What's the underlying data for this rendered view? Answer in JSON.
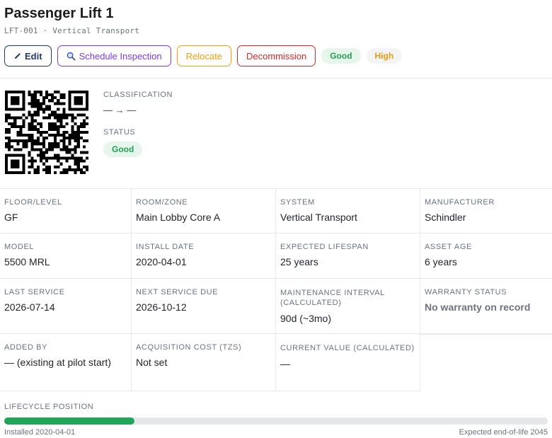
{
  "asset": {
    "title": "Passenger Lift 1",
    "subtitle": "LFT-001 · Vertical Transport"
  },
  "actions": {
    "edit": "Edit",
    "schedule_inspection": "Schedule Inspection",
    "relocate": "Relocate",
    "decommission": "Decommission"
  },
  "badges": {
    "condition": "Good",
    "criticality": "High"
  },
  "icons": {
    "edit": "pencil-icon",
    "schedule_inspection": "magnifier-icon"
  },
  "classification": {
    "label": "CLASSIFICATION",
    "value": "— → —"
  },
  "status": {
    "label": "STATUS",
    "value": "Good"
  },
  "details": [
    [
      {
        "label": "FLOOR/LEVEL",
        "value": "GF"
      },
      {
        "label": "ROOM/ZONE",
        "value": "Main Lobby Core A"
      },
      {
        "label": "SYSTEM",
        "value": "Vertical Transport"
      },
      {
        "label": "MANUFACTURER",
        "value": "Schindler"
      }
    ],
    [
      {
        "label": "MODEL",
        "value": "5500 MRL"
      },
      {
        "label": "INSTALL DATE",
        "value": "2020-04-01"
      },
      {
        "label": "EXPECTED LIFESPAN",
        "value": "25 years"
      },
      {
        "label": "ASSET AGE",
        "value": "6 years"
      }
    ],
    [
      {
        "label": "LAST SERVICE",
        "value": "2026-07-14"
      },
      {
        "label": "NEXT SERVICE DUE",
        "value": "2026-10-12"
      },
      {
        "label": "MAINTENANCE INTERVAL (CALCULATED)",
        "value": "90d (~3mo)"
      },
      {
        "label": "WARRANTY STATUS",
        "value": "No warranty on record"
      }
    ],
    [
      {
        "label": "ADDED BY",
        "value": "— (existing at pilot start)"
      },
      {
        "label": "ACQUISITION COST (TZS)",
        "value": "Not set"
      },
      {
        "label": "CURRENT VALUE (CALCULATED)",
        "value": "—"
      }
    ]
  ],
  "lifecycle": {
    "label": "LIFECYCLE POSITION",
    "progress_percent": 24,
    "start_label": "Installed 2020-04-01",
    "end_label": "Expected end-of-life 2045"
  },
  "colors": {
    "good": "#22a559",
    "high": "#e59a0d",
    "inspect": "#7c3aed",
    "decommission": "#dc2626",
    "relocate": "#f59e0b"
  }
}
